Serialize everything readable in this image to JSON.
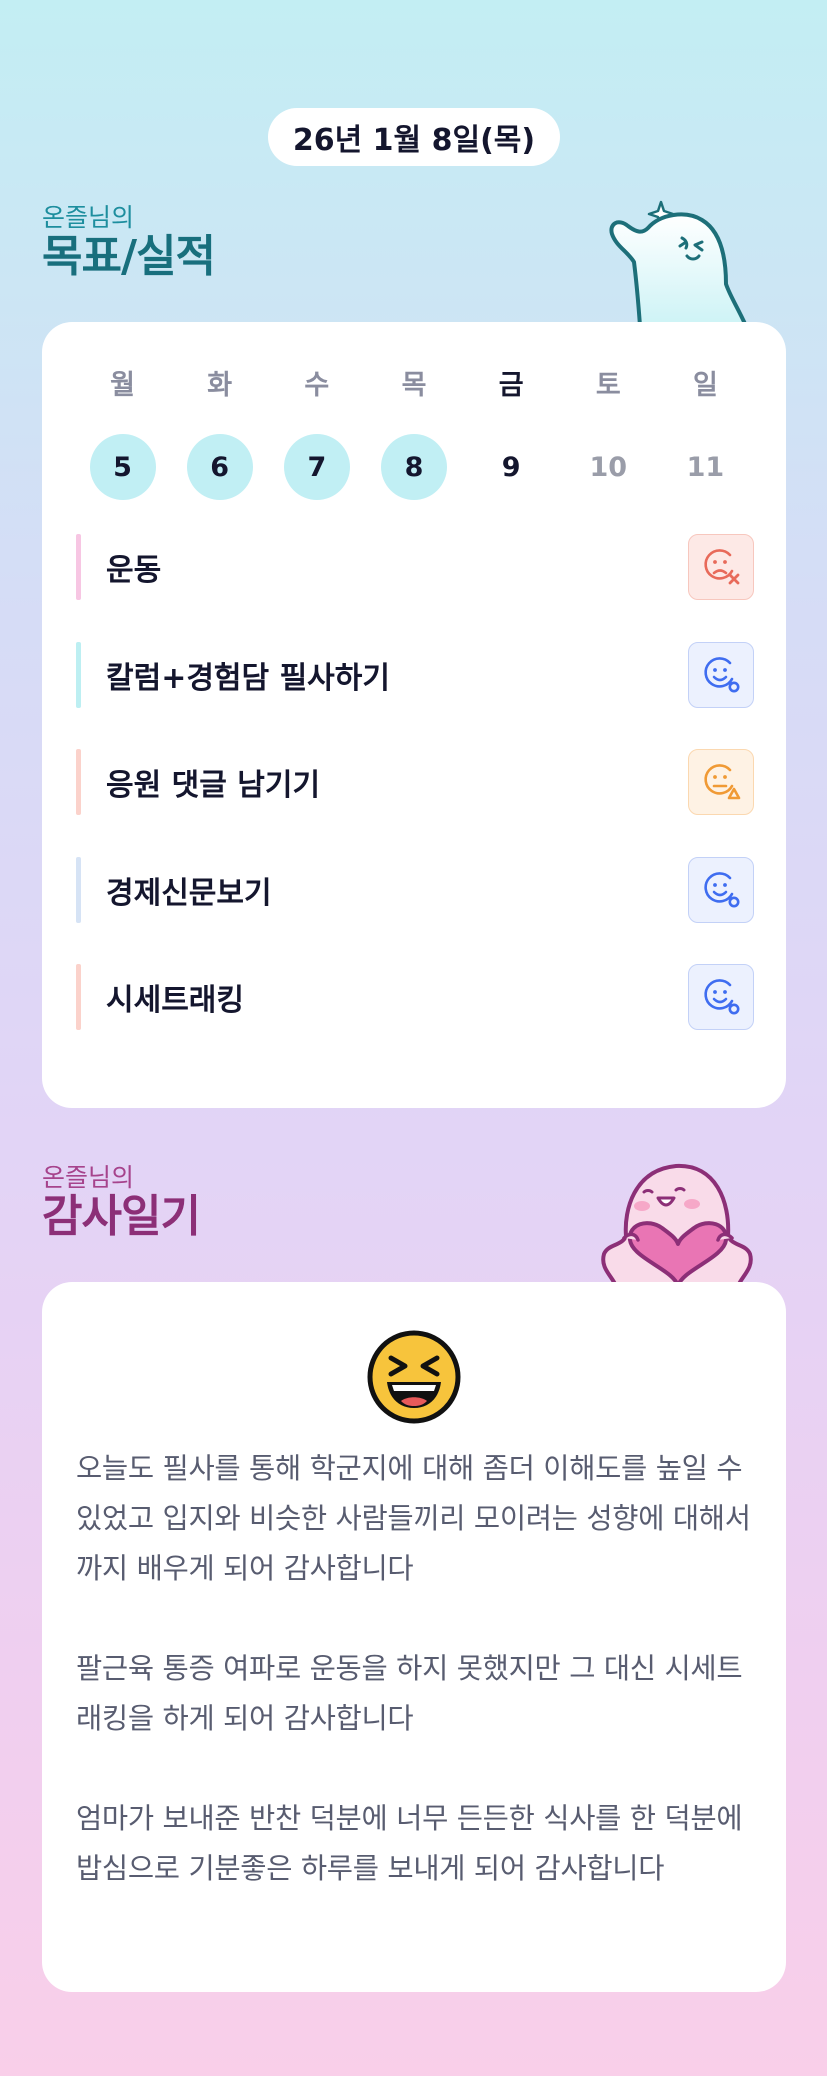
{
  "header": {
    "date": "26년 1월 8일(목)"
  },
  "goals_section": {
    "owner": "온즐님의",
    "title": "목표/실적",
    "mascot": "thumbs-up-ghost-mascot"
  },
  "week": {
    "day_names": [
      "월",
      "화",
      "수",
      "목",
      "금",
      "토",
      "일"
    ],
    "dates": [
      "5",
      "6",
      "7",
      "8",
      "9",
      "10",
      "11"
    ],
    "completed_days": 4,
    "highlighted_day": "금"
  },
  "goals": [
    {
      "label": "운동",
      "bar_color": "#f7c6e3",
      "status": "failed",
      "status_icon": "sad-face-x-icon",
      "status_color": "#e86a5a",
      "status_bg": "#fde9e6",
      "status_border": "#f7c7be"
    },
    {
      "label": "칼럼+경험담 필사하기",
      "bar_color": "#bdeff2",
      "status": "done",
      "status_icon": "smile-face-circle-icon",
      "status_color": "#3f6df0",
      "status_bg": "#ecf1fe",
      "status_border": "#c3d1f7"
    },
    {
      "label": "응원 댓글 남기기",
      "bar_color": "#fbd2cb",
      "status": "partial",
      "status_icon": "neutral-face-triangle-icon",
      "status_color": "#f09a35",
      "status_bg": "#fef2e4",
      "status_border": "#fbd8b0"
    },
    {
      "label": "경제신문보기",
      "bar_color": "#d6e3f5",
      "status": "done",
      "status_icon": "smile-face-circle-icon",
      "status_color": "#3f6df0",
      "status_bg": "#ecf1fe",
      "status_border": "#c3d1f7"
    },
    {
      "label": "시세트래킹",
      "bar_color": "#fbd2cb",
      "status": "done",
      "status_icon": "smile-face-circle-icon",
      "status_color": "#3f6df0",
      "status_bg": "#ecf1fe",
      "status_border": "#c3d1f7"
    }
  ],
  "gratitude_section": {
    "owner": "온즐님의",
    "title": "감사일기",
    "mascot": "heart-hugging-mascot"
  },
  "gratitude": {
    "mood_icon": "laughing-face-emoji-icon",
    "paragraphs": [
      "오늘도 필사를 통해 학군지에 대해 좀더 이해도를 높일 수 있었고 입지와 비슷한 사람들끼리 모이려는 성향에 대해서까지 배우게 되어 감사합니다",
      "팔근육 통증 여파로 운동을 하지 못했지만 그 대신 시세트래킹을 하게 되어 감사합니다",
      "엄마가 보내준 반찬 덕분에 너무 든든한 식사를 한 덕분에 밥심으로 기분좋은 하루를 보내게 되어 감사합니다"
    ]
  }
}
